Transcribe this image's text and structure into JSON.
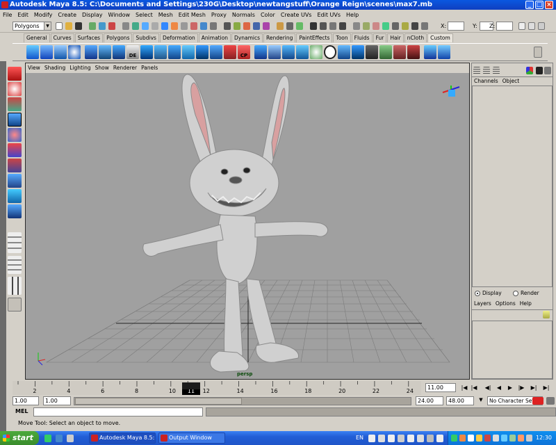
{
  "window": {
    "title": "Autodesk Maya 8.5: C:\\Documents and Settings\\230G\\Desktop\\newtangstuff\\Orange Reign\\scenes\\max7.mb"
  },
  "menubar": [
    "File",
    "Edit",
    "Modify",
    "Create",
    "Display",
    "Window",
    "Select",
    "Mesh",
    "Edit Mesh",
    "Proxy",
    "Normals",
    "Color",
    "Create UVs",
    "Edit UVs",
    "Help"
  ],
  "statusline": {
    "mode": "Polygons",
    "x_label": "X:",
    "y_label": "Y:",
    "z_label": "Z:"
  },
  "shelf_tabs": [
    "General",
    "Curves",
    "Surfaces",
    "Polygons",
    "Subdivs",
    "Deformation",
    "Animation",
    "Dynamics",
    "Rendering",
    "PaintEffects",
    "Toon",
    "Fluids",
    "Fur",
    "Hair",
    "nCloth",
    "Custom"
  ],
  "shelf_active_tab": "Custom",
  "shelf_labels": {
    "de": "DE",
    "cp": "CP"
  },
  "viewport": {
    "menu": [
      "View",
      "Shading",
      "Lighting",
      "Show",
      "Renderer",
      "Panels"
    ],
    "camera": "persp"
  },
  "channelbox": {
    "menu": [
      "Channels",
      "Object"
    ],
    "display_label": "Display",
    "render_label": "Render",
    "layer_menu": [
      "Layers",
      "Options",
      "Help"
    ]
  },
  "timeslider": {
    "ticks": [
      "2",
      "4",
      "6",
      "8",
      "10",
      "12",
      "14",
      "16",
      "18",
      "20",
      "22",
      "24"
    ],
    "current_frame": "11",
    "current_field": "11.00"
  },
  "range": {
    "start": "1.00",
    "playback_start": "1.00",
    "playback_end": "24.00",
    "end": "48.00",
    "character_set": "No Character Set"
  },
  "mel": {
    "label": "MEL"
  },
  "helpline": "Move Tool: Select an object to move.",
  "taskbar": {
    "start": "start",
    "tasks": [
      "Autodesk Maya 8.5: ...",
      "Output Window"
    ],
    "language": "EN",
    "clock": "12:30"
  },
  "colors": {
    "titlebar": "#0a58e0",
    "viewport_bg": "#a0a0a0",
    "taskbar": "#225ed6",
    "start": "#3a8c2c"
  }
}
